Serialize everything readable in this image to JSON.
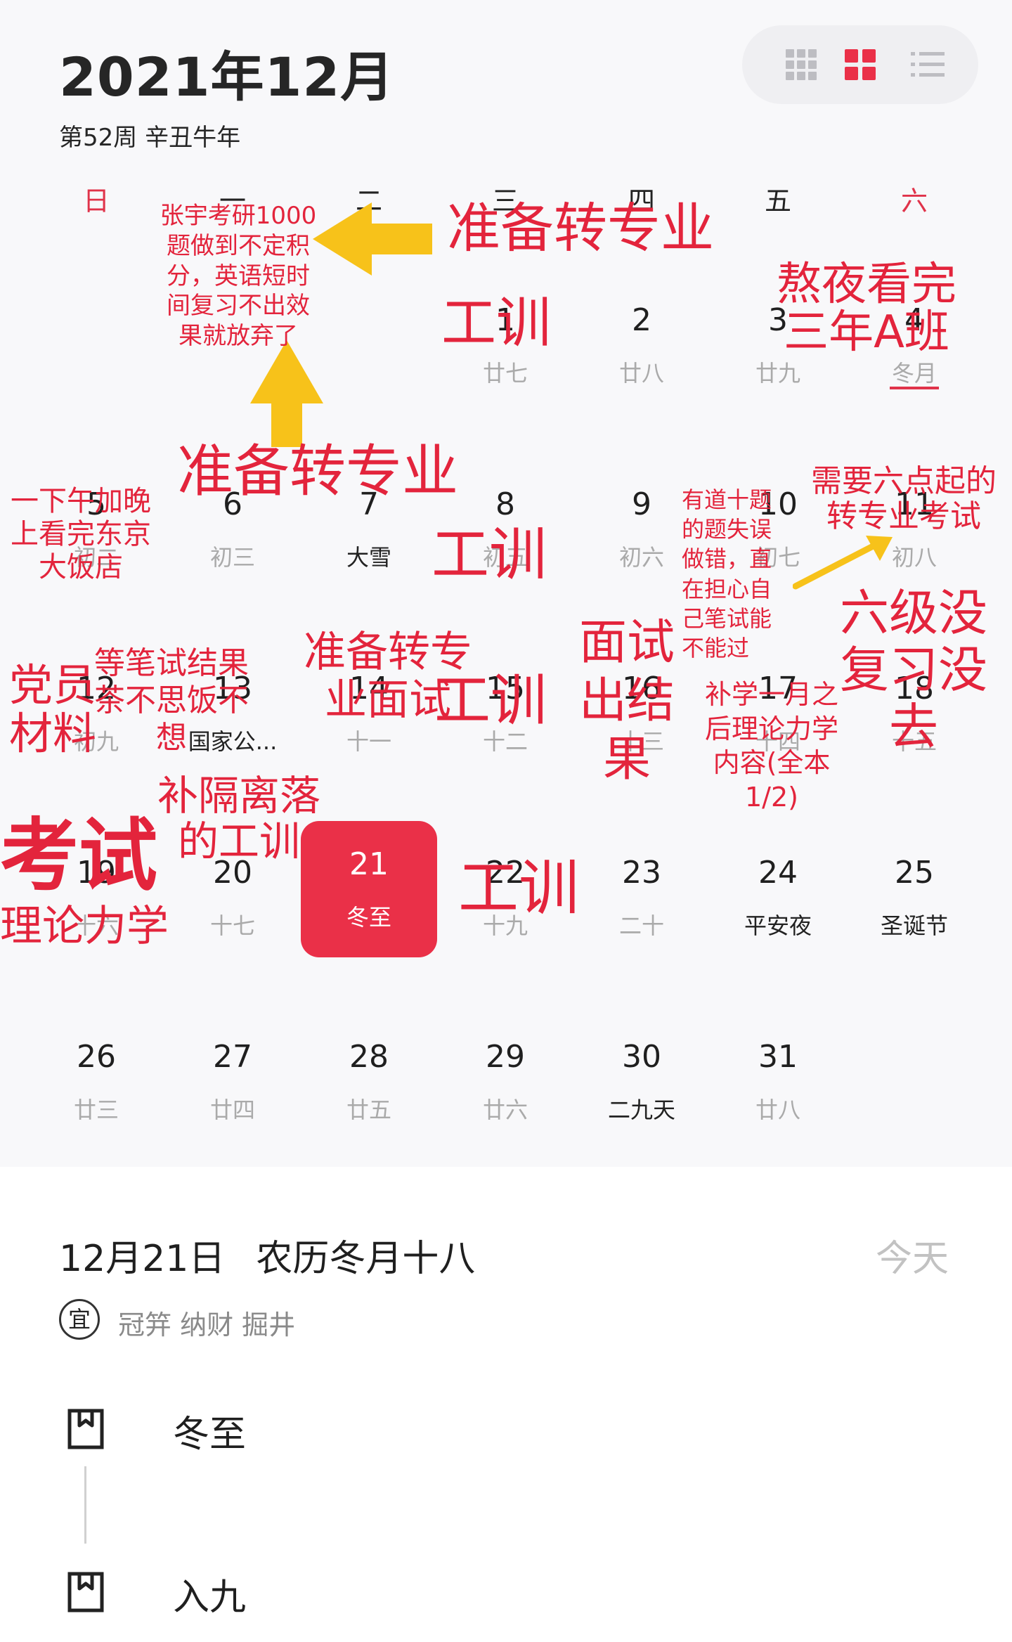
{
  "header": {
    "month_title": "2021年12月",
    "sub_title": "第52周 辛丑牛年"
  },
  "view_switch": {
    "icons": [
      "grid-small-icon",
      "grid-large-icon",
      "list-icon"
    ],
    "active": "grid-large-icon"
  },
  "weekdays": [
    "日",
    "一",
    "二",
    "三",
    "四",
    "五",
    "六"
  ],
  "days": [
    {
      "num": "1",
      "sub": "廿七"
    },
    {
      "num": "2",
      "sub": "廿八"
    },
    {
      "num": "3",
      "sub": "廿九"
    },
    {
      "num": "4",
      "sub": "冬月"
    },
    {
      "num": "5",
      "sub": "初二"
    },
    {
      "num": "6",
      "sub": "初三"
    },
    {
      "num": "7",
      "sub": "大雪"
    },
    {
      "num": "8",
      "sub": "初五"
    },
    {
      "num": "9",
      "sub": "初六"
    },
    {
      "num": "10",
      "sub": "初七"
    },
    {
      "num": "11",
      "sub": "初八"
    },
    {
      "num": "12",
      "sub": "初九"
    },
    {
      "num": "13",
      "sub": "国家公..."
    },
    {
      "num": "14",
      "sub": "十一"
    },
    {
      "num": "15",
      "sub": "十二"
    },
    {
      "num": "16",
      "sub": "十三"
    },
    {
      "num": "17",
      "sub": "十四"
    },
    {
      "num": "18",
      "sub": "十五"
    },
    {
      "num": "19",
      "sub": "十六"
    },
    {
      "num": "20",
      "sub": "十七"
    },
    {
      "num": "21",
      "sub": "冬至"
    },
    {
      "num": "22",
      "sub": "十九"
    },
    {
      "num": "23",
      "sub": "二十"
    },
    {
      "num": "24",
      "sub": "平安夜"
    },
    {
      "num": "25",
      "sub": "圣诞节"
    },
    {
      "num": "26",
      "sub": "廿三"
    },
    {
      "num": "27",
      "sub": "廿四"
    },
    {
      "num": "28",
      "sub": "廿五"
    },
    {
      "num": "29",
      "sub": "廿六"
    },
    {
      "num": "30",
      "sub": "二九天"
    },
    {
      "num": "31",
      "sub": "廿八"
    }
  ],
  "selected_day": "21",
  "detail": {
    "date": "12月21日",
    "lunar": "农历冬月十八",
    "today_label": "今天",
    "yi_badge": "宜",
    "yi_items": "冠笄 纳财 掘井"
  },
  "events": [
    {
      "title": "冬至",
      "icon": "bookmark-calendar-icon"
    },
    {
      "title": "入九",
      "icon": "bookmark-calendar-icon"
    }
  ],
  "annotations": {
    "a1": "张宇考研1000题做到不定积分，英语短时间复习不出效果就放弃了",
    "a2": "准备转专业",
    "a3": "工训",
    "a4": "熬夜看完三年A班",
    "a5": "准备转专业",
    "a6": "工训",
    "a7": "一下午加晚上看完东京大饭店",
    "a8": "有道十题的题失误做错，直在担心自己笔试能不能过",
    "a9": "需要六点起的转专业考试",
    "a10": "六级没复习没去",
    "a11": "党员材料",
    "a12": "等笔试结果茶不思饭不想",
    "a13": "准备转专业面试",
    "a14": "工训",
    "a15": "面试出结果",
    "a16": "补学一月之后理论力学内容(全本1/2)",
    "a17": "补隔离落的工训",
    "a18": "考试",
    "a19": "理论力学",
    "a20": "工训"
  },
  "colors": {
    "accent": "#ea3048",
    "annotation": "#e3243c",
    "arrow": "#f7c21a",
    "weekend": "#e0334a"
  }
}
